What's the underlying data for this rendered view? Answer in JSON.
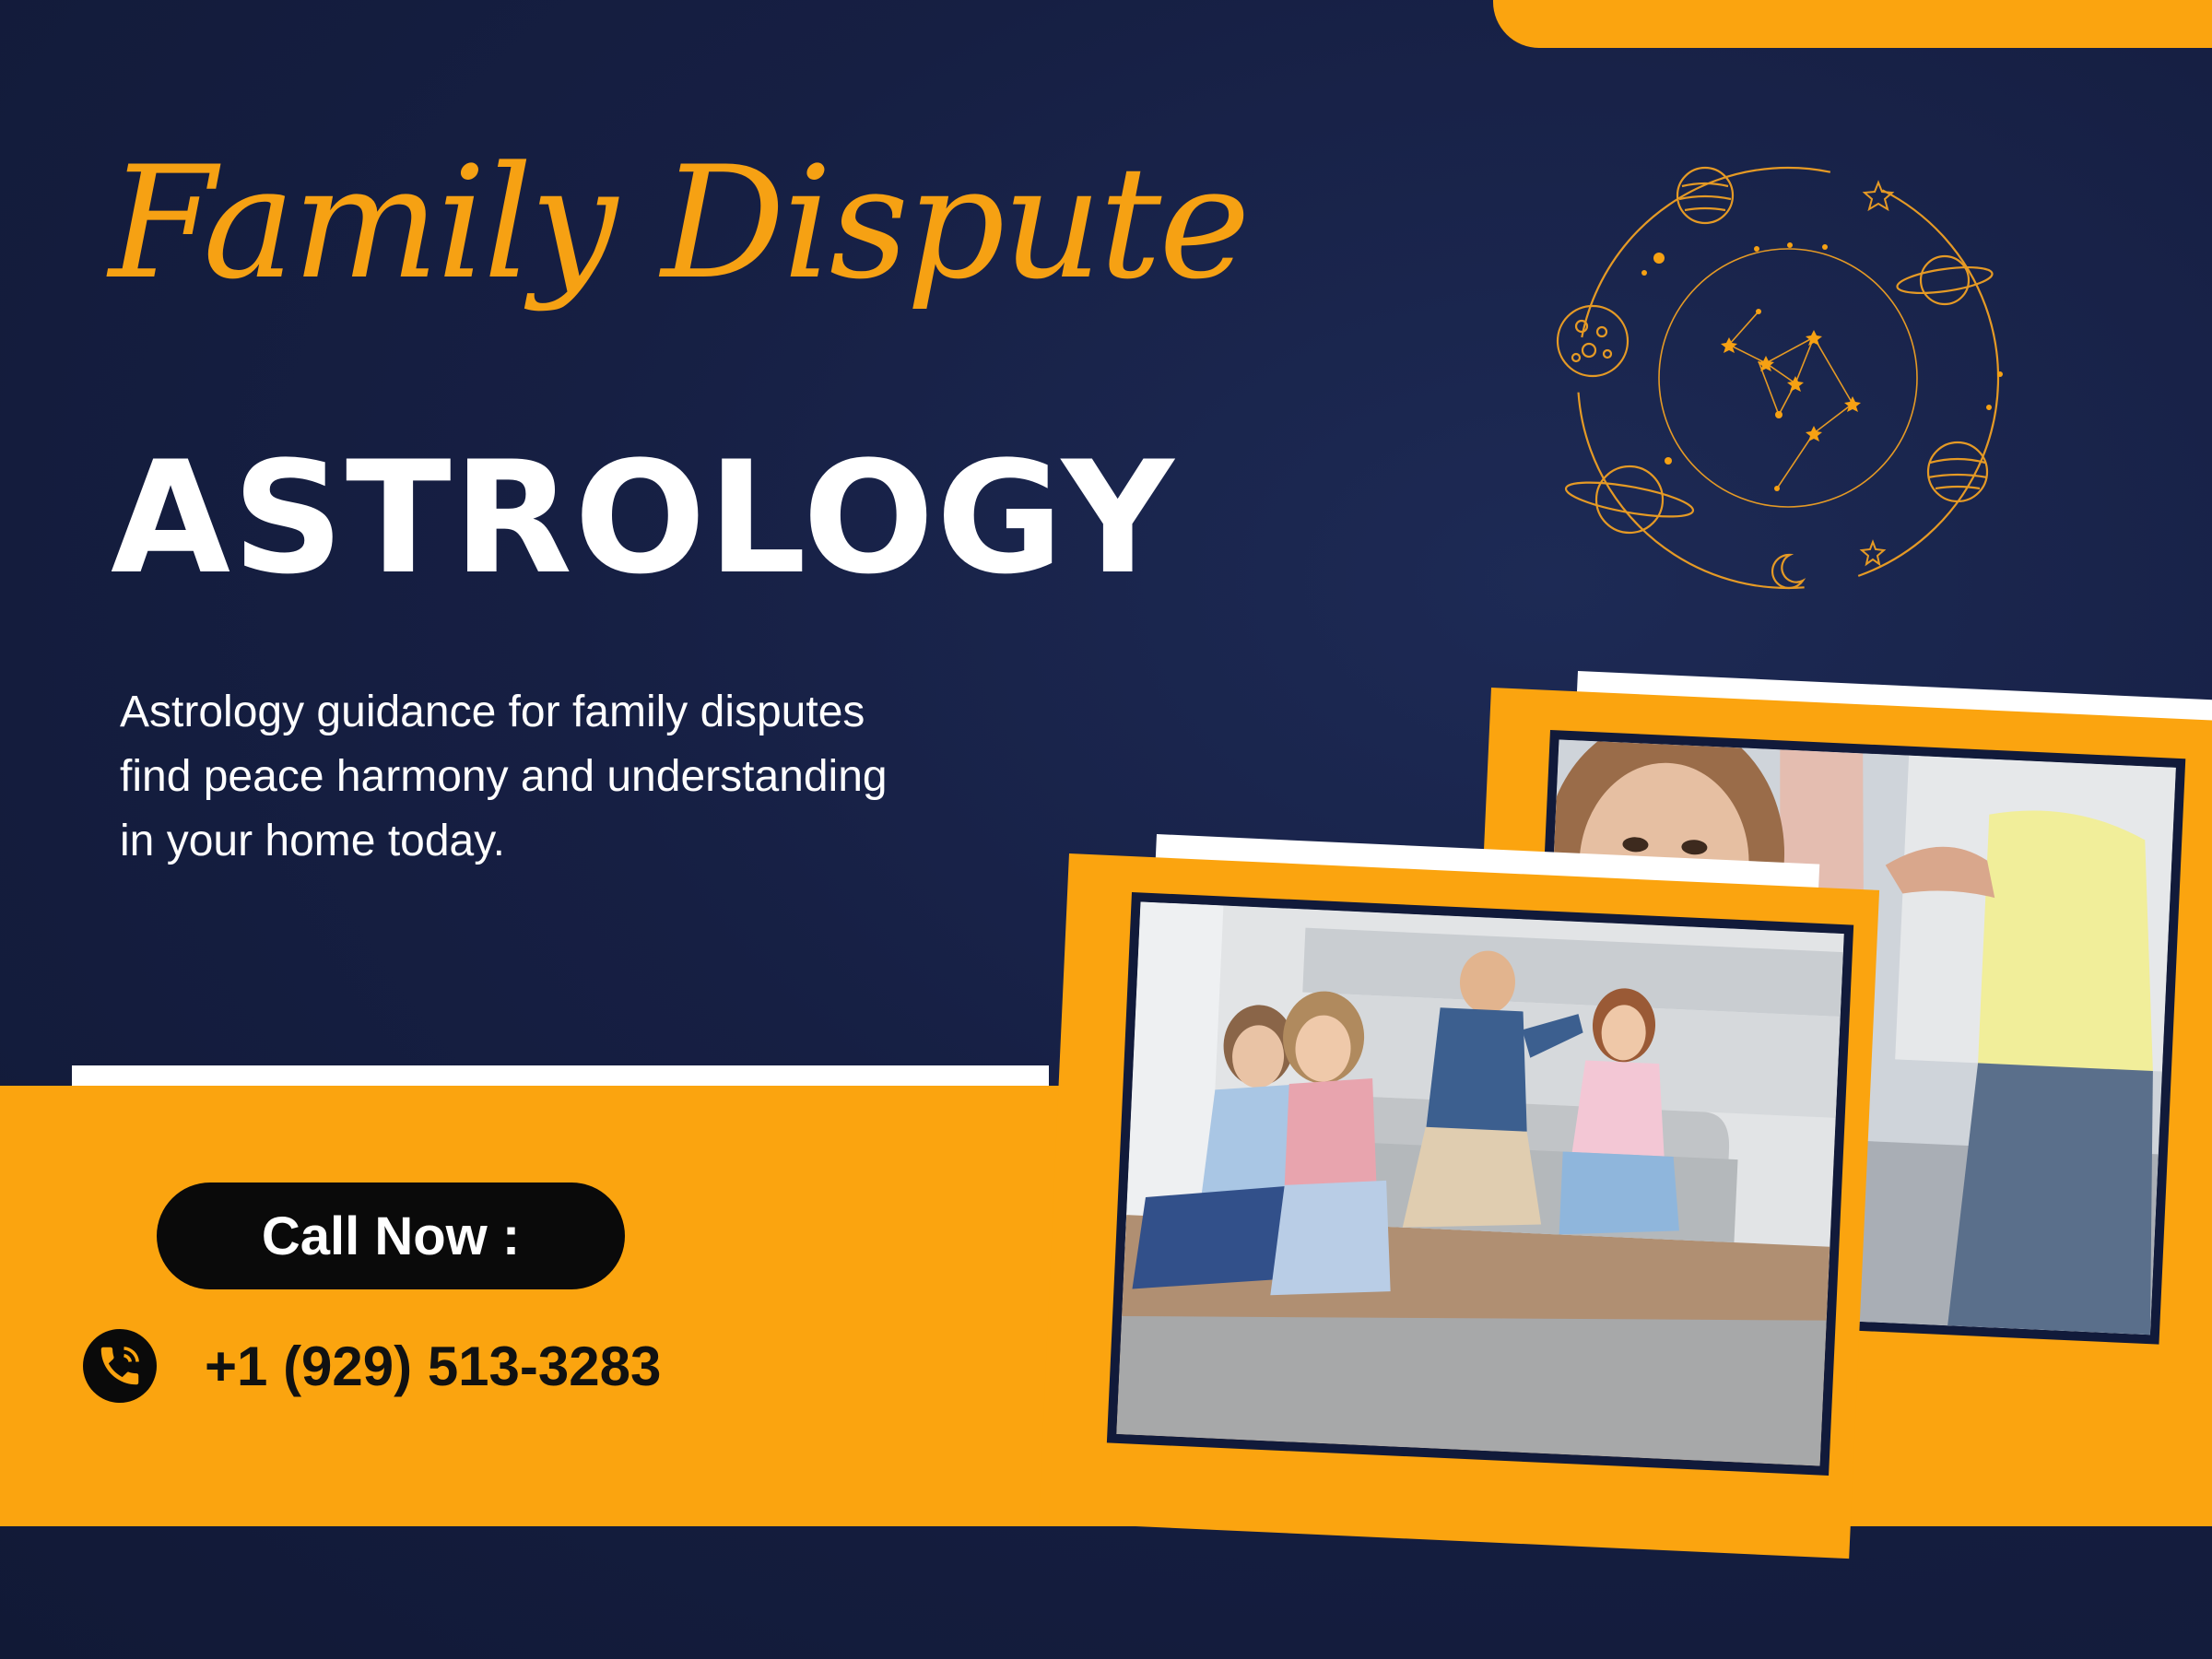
{
  "header": {
    "script_title": "Family Dispute",
    "main_title": "ASTROLOGY"
  },
  "description": {
    "lines": [
      "Astrology guidance for family disputes",
      "find peace harmony and understanding",
      "in your home today."
    ]
  },
  "cta": {
    "label": "Call Now :",
    "phone": "+1 (929) 513-3283",
    "phone_icon": "phone-icon"
  },
  "decorations": {
    "zodiac_icon": "zodiac-orbit-icon",
    "photo_1": "family-argument-photo",
    "photo_2": "sad-girl-photo"
  },
  "colors": {
    "background": "#161f43",
    "accent": "#fba40f",
    "title_script": "#f6a113",
    "text_light": "#ffffff",
    "text_dark": "#111111"
  }
}
